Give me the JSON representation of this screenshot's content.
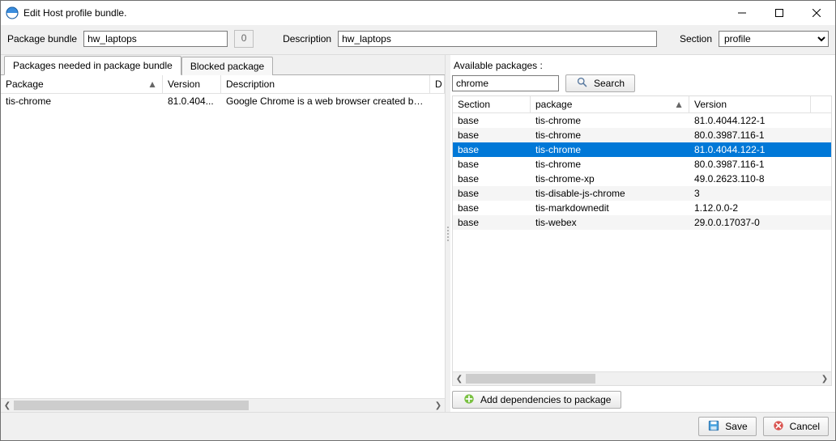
{
  "window": {
    "title": "Edit Host profile bundle."
  },
  "fields": {
    "package_bundle_label": "Package bundle",
    "package_bundle_value": "hw_laptops",
    "count": "0",
    "description_label": "Description",
    "description_value": "hw_laptops",
    "section_label": "Section",
    "section_value": "profile"
  },
  "tabs": {
    "needed": "Packages needed in package bundle",
    "blocked": "Blocked package"
  },
  "left_grid": {
    "headers": {
      "package": "Package",
      "version": "Version",
      "description": "Description",
      "extra": "D"
    },
    "rows": [
      {
        "package": "tis-chrome",
        "version": "81.0.404...",
        "description": "Google Chrome is a web browser created by ..."
      }
    ]
  },
  "right": {
    "available_label": "Available packages :",
    "search_value": "chrome",
    "search_btn": "Search",
    "headers": {
      "section": "Section",
      "package": "package",
      "version": "Version"
    },
    "rows": [
      {
        "section": "base",
        "package": "tis-chrome",
        "version": "81.0.4044.122-1",
        "sel": false,
        "alt": false
      },
      {
        "section": "base",
        "package": "tis-chrome",
        "version": "80.0.3987.116-1",
        "sel": false,
        "alt": true
      },
      {
        "section": "base",
        "package": "tis-chrome",
        "version": "81.0.4044.122-1",
        "sel": true,
        "alt": false
      },
      {
        "section": "base",
        "package": "tis-chrome",
        "version": "80.0.3987.116-1",
        "sel": false,
        "alt": false
      },
      {
        "section": "base",
        "package": "tis-chrome-xp",
        "version": "49.0.2623.110-8",
        "sel": false,
        "alt": false
      },
      {
        "section": "base",
        "package": "tis-disable-js-chrome",
        "version": "3",
        "sel": false,
        "alt": true
      },
      {
        "section": "base",
        "package": "tis-markdownedit",
        "version": "1.12.0.0-2",
        "sel": false,
        "alt": false
      },
      {
        "section": "base",
        "package": "tis-webex",
        "version": "29.0.0.17037-0",
        "sel": false,
        "alt": true
      }
    ],
    "add_btn": "Add dependencies to package"
  },
  "footer": {
    "save": "Save",
    "cancel": "Cancel"
  }
}
